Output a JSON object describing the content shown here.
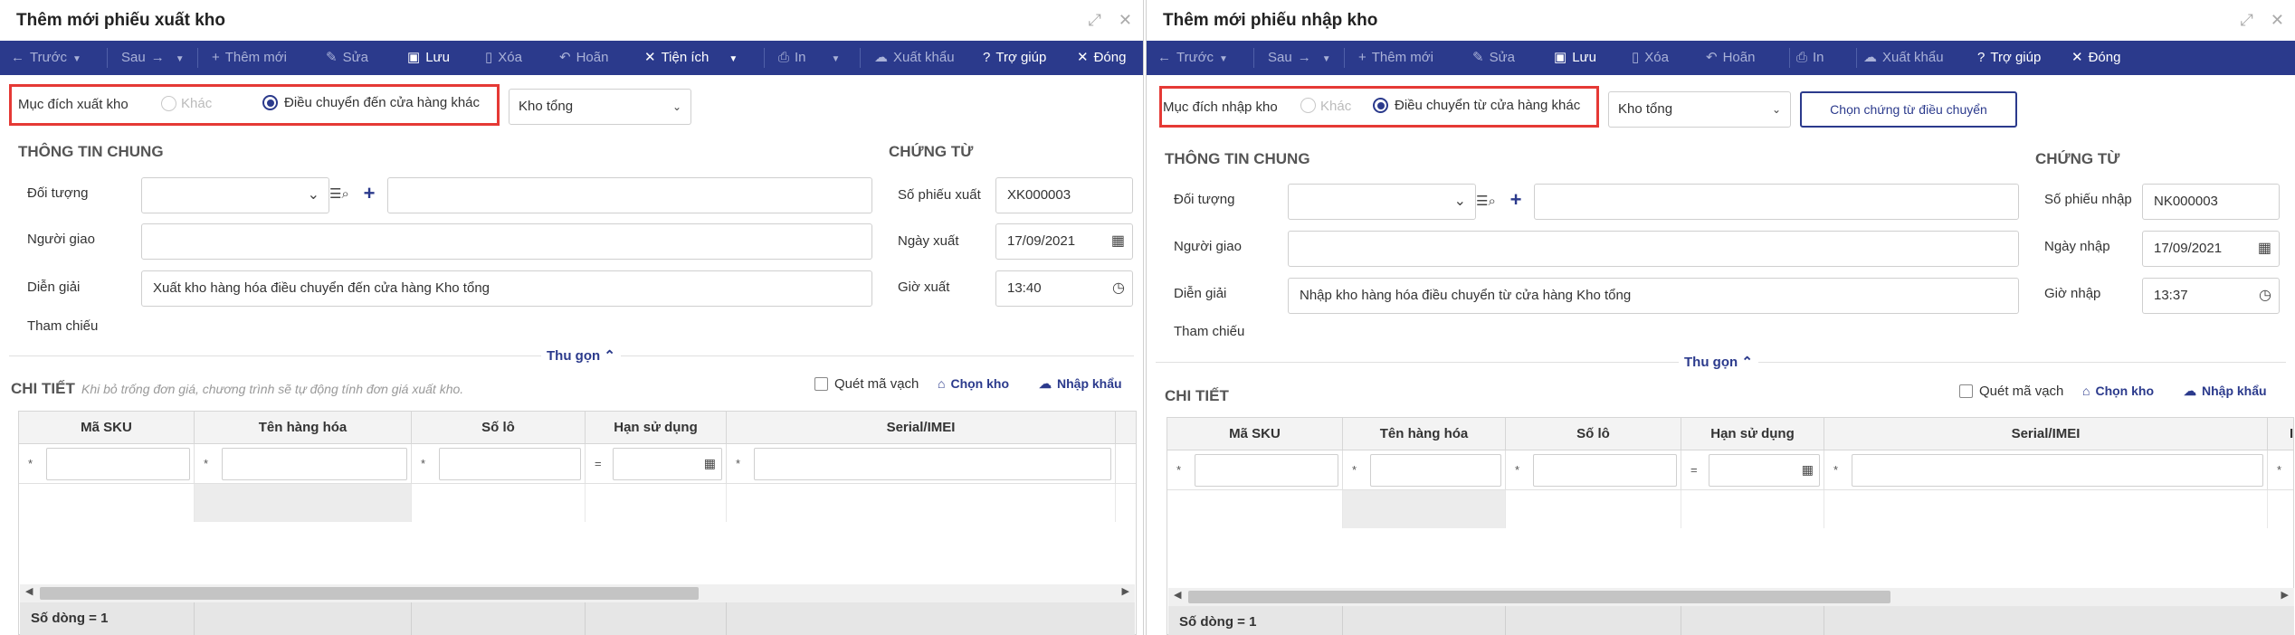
{
  "left": {
    "title": "Thêm mới phiếu xuất kho",
    "window_controls": {
      "expand": "⤢",
      "close": "✕"
    },
    "toolbar": {
      "prev": "Trước",
      "next": "Sau",
      "add": "Thêm mới",
      "edit": "Sửa",
      "save": "Lưu",
      "delete": "Xóa",
      "undo": "Hoãn",
      "utilities": "Tiện ích",
      "print": "In",
      "export": "Xuất khẩu",
      "help": "Trợ giúp",
      "close": "Đóng"
    },
    "purpose": {
      "label": "Mục đích xuất kho",
      "option_other": "Khác",
      "option_transfer": "Điều chuyển đến cửa hàng khác",
      "selected": "transfer",
      "warehouse": "Kho tổng"
    },
    "general": {
      "heading": "THÔNG TIN CHUNG",
      "object_label": "Đối tượng",
      "object_value": "",
      "object_name": "",
      "person_label": "Người giao",
      "person_value": "",
      "desc_label": "Diễn giải",
      "desc_value": "Xuất kho hàng hóa điều chuyển đến cửa hàng Kho tổng",
      "ref_label": "Tham chiếu"
    },
    "voucher": {
      "heading": "CHỨNG TỪ",
      "number_label": "Số phiếu xuất",
      "number_value": "XK000003",
      "date_label": "Ngày xuất",
      "date_value": "17/09/2021",
      "time_label": "Giờ xuất",
      "time_value": "13:40"
    },
    "collapse_label": "Thu gọn",
    "detail": {
      "heading": "CHI TIẾT",
      "note": "Khi bỏ trống đơn giá, chương trình sẽ tự động tính đơn giá xuất kho.",
      "scan_label": "Quét mã vạch",
      "choose_warehouse": "Chọn kho",
      "import_label": "Nhập khẩu",
      "columns": [
        "Mã SKU",
        "Tên hàng hóa",
        "Số lô",
        "Hạn sử dụng",
        "Serial/IMEI"
      ],
      "filter_ops": [
        "*",
        "*",
        "*",
        "=",
        "*"
      ],
      "row_count": "Số dòng = 1"
    }
  },
  "right": {
    "title": "Thêm mới phiếu nhập kho",
    "window_controls": {
      "expand": "⤢",
      "close": "✕"
    },
    "toolbar": {
      "prev": "Trước",
      "next": "Sau",
      "add": "Thêm mới",
      "edit": "Sửa",
      "save": "Lưu",
      "delete": "Xóa",
      "undo": "Hoãn",
      "print": "In",
      "export": "Xuất khẩu",
      "help": "Trợ giúp",
      "close": "Đóng"
    },
    "purpose": {
      "label": "Mục đích nhập kho",
      "option_other": "Khác",
      "option_transfer": "Điều chuyển từ cửa hàng khác",
      "selected": "transfer",
      "warehouse": "Kho tổng",
      "choose_voucher": "Chọn chứng từ điều chuyển"
    },
    "general": {
      "heading": "THÔNG TIN CHUNG",
      "object_label": "Đối tượng",
      "object_value": "",
      "object_name": "",
      "person_label": "Người giao",
      "person_value": "",
      "desc_label": "Diễn giải",
      "desc_value": "Nhập kho hàng hóa điều chuyển từ cửa hàng Kho tổng",
      "ref_label": "Tham chiếu"
    },
    "voucher": {
      "heading": "CHỨNG TỪ",
      "number_label": "Số phiếu nhập",
      "number_value": "NK000003",
      "date_label": "Ngày nhập",
      "date_value": "17/09/2021",
      "time_label": "Giờ nhập",
      "time_value": "13:37"
    },
    "collapse_label": "Thu gọn",
    "detail": {
      "heading": "CHI TIẾT",
      "scan_label": "Quét mã vạch",
      "choose_warehouse": "Chọn kho",
      "import_label": "Nhập khẩu",
      "columns": [
        "Mã SKU",
        "Tên hàng hóa",
        "Số lô",
        "Hạn sử dụng",
        "Serial/IMEI",
        "I"
      ],
      "filter_ops": [
        "*",
        "*",
        "*",
        "=",
        "*",
        "*"
      ],
      "row_count": "Số dòng = 1"
    }
  },
  "colors": {
    "toolbar": "#2b3a8c",
    "highlight": "#e53935",
    "accent": "#2b3a8c"
  }
}
